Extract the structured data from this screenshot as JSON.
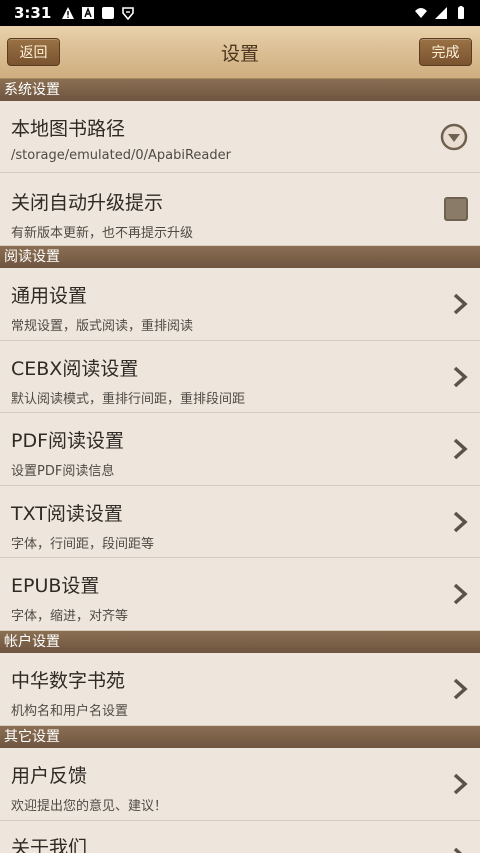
{
  "status_bar": {
    "time": "3:31",
    "icons": [
      "warning-icon",
      "a-box-icon",
      "square-icon",
      "shield-icon"
    ],
    "right_icons": [
      "wifi-icon",
      "signal-icon",
      "battery-icon"
    ]
  },
  "header": {
    "back_label": "返回",
    "title": "设置",
    "done_label": "完成"
  },
  "sections": {
    "system": {
      "label": "系统设置",
      "items": [
        {
          "title": "本地图书路径",
          "subtitle": "/storage/emulated/0/ApabiReader",
          "control": "dropdown"
        },
        {
          "title": "关闭自动升级提示",
          "subtitle": "有新版本更新，也不再提示升级",
          "control": "checkbox",
          "checked": false
        }
      ]
    },
    "reading": {
      "label": "阅读设置",
      "items": [
        {
          "title": "通用设置",
          "subtitle": "常规设置，版式阅读，重排阅读"
        },
        {
          "title": "CEBX阅读设置",
          "subtitle": "默认阅读模式，重排行间距，重排段间距"
        },
        {
          "title": "PDF阅读设置",
          "subtitle": "设置PDF阅读信息"
        },
        {
          "title": "TXT阅读设置",
          "subtitle": "字体，行间距，段间距等"
        },
        {
          "title": "EPUB设置",
          "subtitle": "字体，缩进，对齐等"
        }
      ]
    },
    "account": {
      "label": "帐户设置",
      "items": [
        {
          "title": "中华数字书苑",
          "subtitle": "机构名和用户名设置"
        }
      ]
    },
    "other": {
      "label": "其它设置",
      "items": [
        {
          "title": "用户反馈",
          "subtitle": "欢迎提出您的意见、建议！"
        },
        {
          "title": "关于我们",
          "subtitle": ""
        }
      ]
    }
  },
  "colors": {
    "background": "#eee6dc",
    "section_bar": "#7a6049",
    "header_button": "#8a6239"
  }
}
